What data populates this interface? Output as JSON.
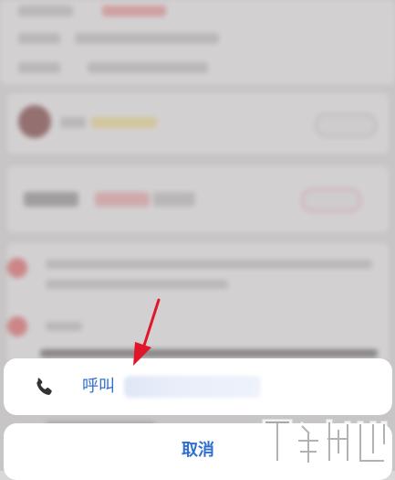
{
  "action_sheet": {
    "call_label": "呼叫",
    "cancel_label": "取消"
  },
  "icons": {
    "phone": "phone-icon",
    "arrow": "annotation-arrow-icon",
    "watermark": "watermark-logo-icon"
  },
  "colors": {
    "accent": "#2f6fd1",
    "annotation": "#e0162b",
    "sheet_bg": "#ffffff"
  }
}
